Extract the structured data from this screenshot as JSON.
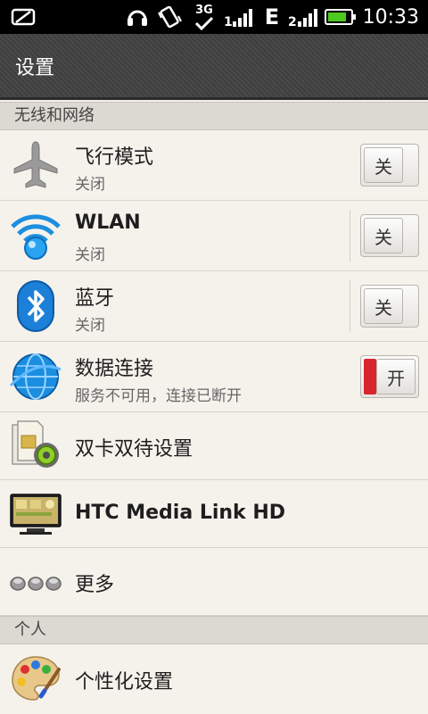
{
  "status_bar": {
    "time": "10:33",
    "network_type": "3G",
    "data_indicator": "E",
    "sim2_label": "2",
    "icons": [
      "notification-icon",
      "headset-icon",
      "vibrate-icon",
      "3g-check-icon",
      "signal-icon",
      "edge-icon",
      "signal2-icon",
      "battery-icon"
    ],
    "battery_color": "#4dc81e"
  },
  "header": {
    "title": "设置"
  },
  "sections": {
    "wireless": "无线和网络",
    "personal": "个人"
  },
  "rows": {
    "airplane": {
      "label": "飞行模式",
      "sub": "关闭",
      "toggle": "关",
      "icon": "airplane-icon"
    },
    "wlan": {
      "label": "WLAN",
      "sub": "关闭",
      "toggle": "关",
      "icon": "wifi-icon"
    },
    "bluetooth": {
      "label": "蓝牙",
      "sub": "关闭",
      "toggle": "关",
      "icon": "bluetooth-icon"
    },
    "data": {
      "label": "数据连接",
      "sub": "服务不可用，连接已断开",
      "toggle": "开",
      "icon": "globe-icon"
    },
    "dual_sim": {
      "label": "双卡双待设置",
      "icon": "sim-gear-icon"
    },
    "media_link": {
      "label": "HTC Media Link HD",
      "icon": "tv-icon"
    },
    "more": {
      "label": "更多",
      "icon": "more-dots-icon"
    },
    "personalize": {
      "label": "个性化设置",
      "icon": "palette-icon"
    }
  },
  "colors": {
    "toggle_on": "#d8262f",
    "accent_blue": "#1c8fe0"
  }
}
